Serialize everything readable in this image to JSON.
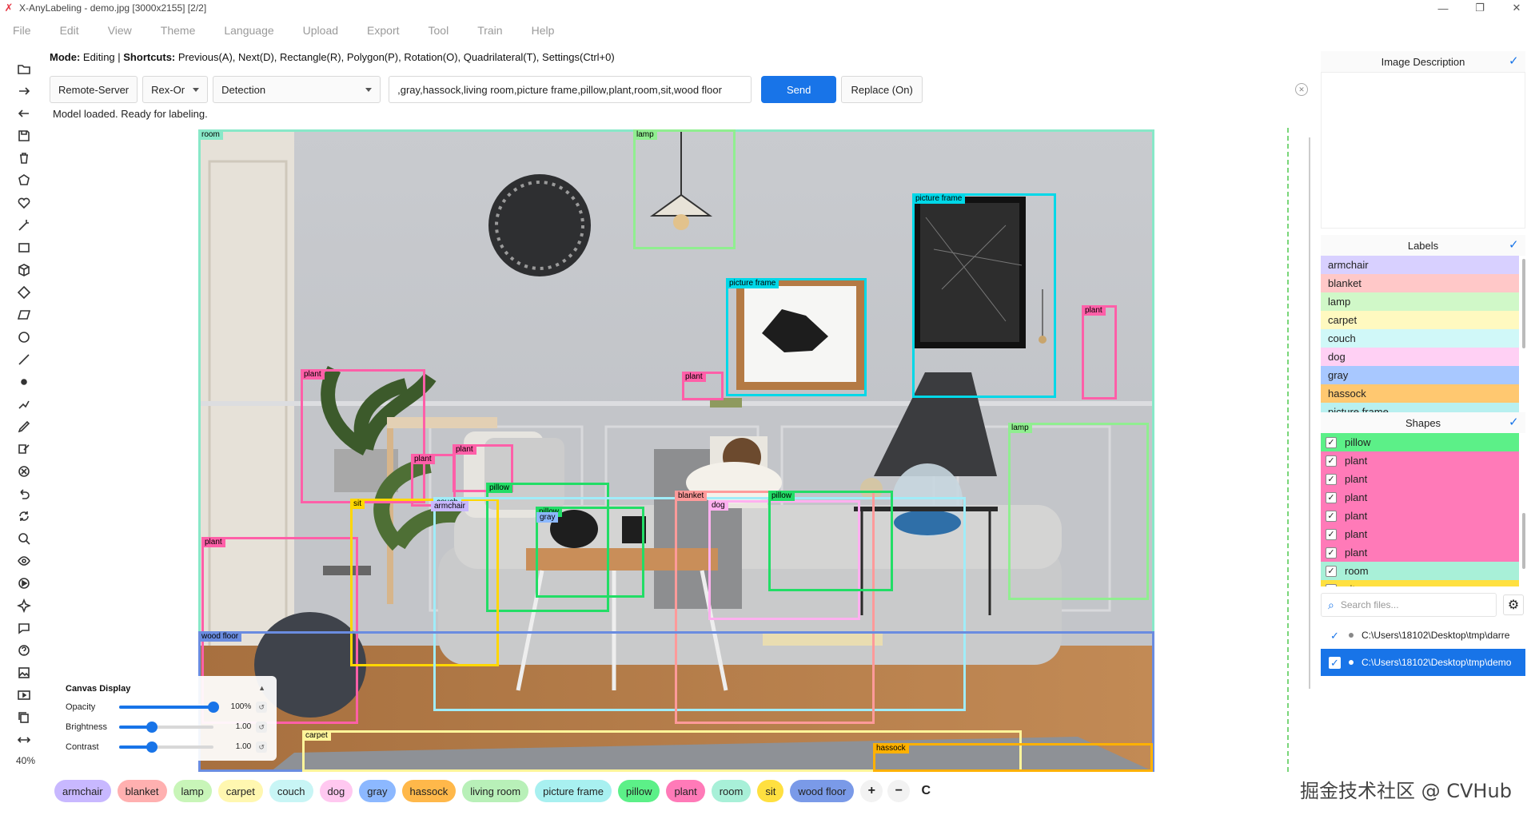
{
  "window": {
    "title": "X-AnyLabeling - demo.jpg [3000x2155] [2/2]",
    "minimize_glyph": "—",
    "maximize_glyph": "❐",
    "close_glyph": "✕"
  },
  "menu": [
    "File",
    "Edit",
    "View",
    "Theme",
    "Language",
    "Upload",
    "Export",
    "Tool",
    "Train",
    "Help"
  ],
  "mode_line": {
    "mode_label": "Mode:",
    "mode_value": "Editing",
    "shortcuts_label": "Shortcuts:",
    "shortcuts_value": "Previous(A), Next(D), Rectangle(R), Polygon(P), Rotation(O), Quadrilateral(T), Settings(Ctrl+0)"
  },
  "controls": {
    "server": "Remote-Server",
    "model": "Rex-Omni",
    "task": "Detection",
    "prompt_text": ",gray,hassock,living room,picture frame,pillow,plant,room,sit,wood floor",
    "send": "Send",
    "replace": "Replace (On)"
  },
  "status": "Model loaded. Ready for labeling.",
  "zoom": "40%",
  "canvas_display": {
    "title": "Canvas Display",
    "collapse_glyph": "▲",
    "opacity": {
      "label": "Opacity",
      "value": "100%",
      "level": 1.0
    },
    "brightness": {
      "label": "Brightness",
      "value": "1.00",
      "level": 0.35
    },
    "contrast": {
      "label": "Contrast",
      "value": "1.00",
      "level": 0.35
    }
  },
  "annotations": [
    {
      "label": "room",
      "color": "#88e8c8"
    },
    {
      "label": "lamp",
      "color": "#90ee90"
    },
    {
      "label": "picture frame",
      "color": "#00d8e8"
    },
    {
      "label": "picture frame",
      "color": "#00d8e8"
    },
    {
      "label": "plant",
      "color": "#ff5fa8"
    },
    {
      "label": "plant",
      "color": "#ff5fa8"
    },
    {
      "label": "plant",
      "color": "#ff5fa8"
    },
    {
      "label": "plant",
      "color": "#ff5fa8"
    },
    {
      "label": "plant",
      "color": "#ff5fa8"
    },
    {
      "label": "plant",
      "color": "#ff5fa8"
    },
    {
      "label": "lamp",
      "color": "#90ee90"
    },
    {
      "label": "pillow",
      "color": "#22dd66"
    },
    {
      "label": "pillow",
      "color": "#22dd66"
    },
    {
      "label": "sit",
      "color": "#ffd700"
    },
    {
      "label": "couch",
      "color": "#a0ecf8"
    },
    {
      "label": "armchair",
      "color": "#c8b8ff"
    },
    {
      "label": "gray",
      "color": "#8cb8ff"
    },
    {
      "label": "blanket",
      "color": "#ff9a9a"
    },
    {
      "label": "dog",
      "color": "#ffb0f0"
    },
    {
      "label": "pillow",
      "color": "#22dd66"
    },
    {
      "label": "wood floor",
      "color": "#6a8ce0"
    },
    {
      "label": "carpet",
      "color": "#fff59a"
    },
    {
      "label": "hassock",
      "color": "#ffb100"
    }
  ],
  "chips": [
    {
      "label": "armchair",
      "color": "#c8b8ff"
    },
    {
      "label": "blanket",
      "color": "#ffb0b0"
    },
    {
      "label": "lamp",
      "color": "#c8f5b8"
    },
    {
      "label": "carpet",
      "color": "#fff7b0"
    },
    {
      "label": "couch",
      "color": "#c8f5f5"
    },
    {
      "label": "dog",
      "color": "#ffc8f0"
    },
    {
      "label": "gray",
      "color": "#8cb8ff"
    },
    {
      "label": "hassock",
      "color": "#ffb84a"
    },
    {
      "label": "living room",
      "color": "#b8f0b8"
    },
    {
      "label": "picture frame",
      "color": "#a8f0f0"
    },
    {
      "label": "pillow",
      "color": "#5cf088"
    },
    {
      "label": "plant",
      "color": "#ff7ab8"
    },
    {
      "label": "room",
      "color": "#a8f0d8"
    },
    {
      "label": "sit",
      "color": "#ffe040"
    },
    {
      "label": "wood floor",
      "color": "#7a9ae8"
    }
  ],
  "chip_controls": [
    "+",
    "−",
    "C"
  ],
  "right_panel": {
    "image_description": {
      "title": "Image Description",
      "checked": true
    },
    "labels": {
      "title": "Labels",
      "items": [
        {
          "label": "armchair",
          "color": "#d8d0ff"
        },
        {
          "label": "blanket",
          "color": "#ffc8c8"
        },
        {
          "label": "lamp",
          "color": "#d0f8c8"
        },
        {
          "label": "carpet",
          "color": "#fff9c0"
        },
        {
          "label": "couch",
          "color": "#d0f8f8"
        },
        {
          "label": "dog",
          "color": "#ffd0f4"
        },
        {
          "label": "gray",
          "color": "#a8c8ff"
        },
        {
          "label": "hassock",
          "color": "#ffc870"
        },
        {
          "label": "picture frame",
          "color": "#b8f0f0"
        }
      ]
    },
    "shapes": {
      "title": "Shapes",
      "items": [
        {
          "label": "pillow",
          "color": "#5cf088"
        },
        {
          "label": "plant",
          "color": "#ff7ab8"
        },
        {
          "label": "plant",
          "color": "#ff7ab8"
        },
        {
          "label": "plant",
          "color": "#ff7ab8"
        },
        {
          "label": "plant",
          "color": "#ff7ab8"
        },
        {
          "label": "plant",
          "color": "#ff7ab8"
        },
        {
          "label": "plant",
          "color": "#ff7ab8"
        },
        {
          "label": "room",
          "color": "#a8f0d8"
        },
        {
          "label": "sit",
          "color": "#ffe040"
        }
      ]
    },
    "search_placeholder": "Search files...",
    "files": [
      {
        "path": "C:\\Users\\18102\\Desktop\\tmp\\darre",
        "selected": false
      },
      {
        "path": "C:\\Users\\18102\\Desktop\\tmp\\demo",
        "selected": true
      }
    ]
  },
  "watermark": "掘金技术社区 @ CVHub"
}
